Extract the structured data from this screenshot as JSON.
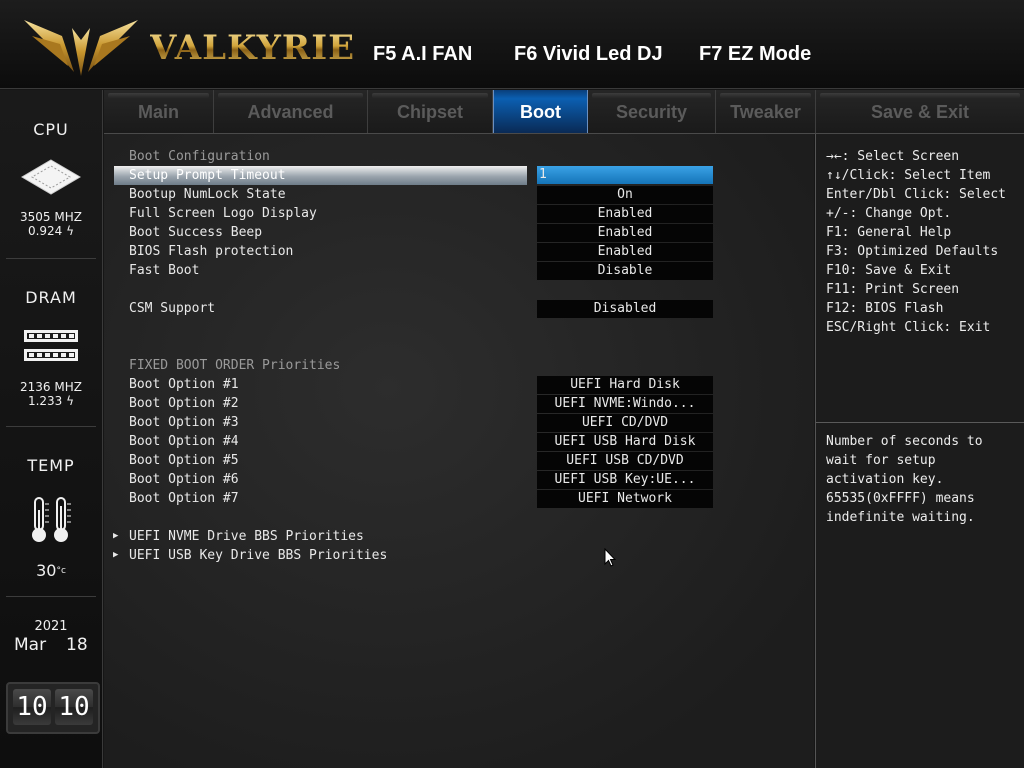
{
  "header": {
    "brand": "VALKYRIE",
    "hotkeys": [
      "F5 A.I FAN",
      "F6 Vivid Led DJ",
      "F7 EZ Mode"
    ]
  },
  "sidebar": {
    "cpu": {
      "label": "CPU",
      "freq": "3505 MHZ",
      "volt": "0.924"
    },
    "dram": {
      "label": "DRAM",
      "freq": "2136 MHZ",
      "volt": "1.233"
    },
    "temp": {
      "label": "TEMP",
      "value": "30"
    },
    "date": {
      "year": "2021",
      "month": "Mar",
      "day": "18"
    },
    "time": {
      "hour": "10",
      "minute": "10"
    }
  },
  "tabs": [
    {
      "label": "Main"
    },
    {
      "label": "Advanced"
    },
    {
      "label": "Chipset"
    },
    {
      "label": "Boot",
      "active": true
    },
    {
      "label": "Security"
    },
    {
      "label": "Tweaker"
    },
    {
      "label": "Save & Exit"
    }
  ],
  "main": {
    "boot_config_title": "Boot Configuration",
    "rows": [
      {
        "label": "Setup Prompt Timeout",
        "value": "1",
        "selected": true
      },
      {
        "label": "Bootup NumLock State",
        "value": "On"
      },
      {
        "label": "Full Screen Logo Display",
        "value": "Enabled"
      },
      {
        "label": "Boot Success Beep",
        "value": "Enabled"
      },
      {
        "label": "BIOS Flash protection",
        "value": "Enabled"
      },
      {
        "label": "Fast Boot",
        "value": "Disable"
      }
    ],
    "csm": {
      "label": "CSM Support",
      "value": "Disabled"
    },
    "boot_order_title": "FIXED BOOT ORDER Priorities",
    "boot_options": [
      {
        "label": "Boot Option #1",
        "value": "UEFI Hard Disk"
      },
      {
        "label": "Boot Option #2",
        "value": "UEFI NVME:Windo..."
      },
      {
        "label": "Boot Option #3",
        "value": "UEFI CD/DVD"
      },
      {
        "label": "Boot Option #4",
        "value": "UEFI USB Hard Disk"
      },
      {
        "label": "Boot Option #5",
        "value": "UEFI USB CD/DVD"
      },
      {
        "label": "Boot Option #6",
        "value": "UEFI USB Key:UE..."
      },
      {
        "label": "Boot Option #7",
        "value": "UEFI Network"
      }
    ],
    "submenus": [
      {
        "label": "UEFI NVME Drive BBS Priorities"
      },
      {
        "label": "UEFI USB Key Drive BBS Priorities"
      }
    ]
  },
  "help": {
    "keys": [
      "→←: Select Screen",
      "↑↓/Click: Select Item",
      "Enter/Dbl Click: Select",
      "+/-: Change Opt.",
      "F1: General Help",
      "F3: Optimized Defaults",
      "F10: Save & Exit",
      "F11: Print Screen",
      "F12: BIOS Flash",
      "ESC/Right Click: Exit"
    ],
    "description": [
      "Number of seconds to",
      "wait for setup",
      "activation key.",
      "65535(0xFFFF) means",
      "indefinite waiting."
    ]
  }
}
